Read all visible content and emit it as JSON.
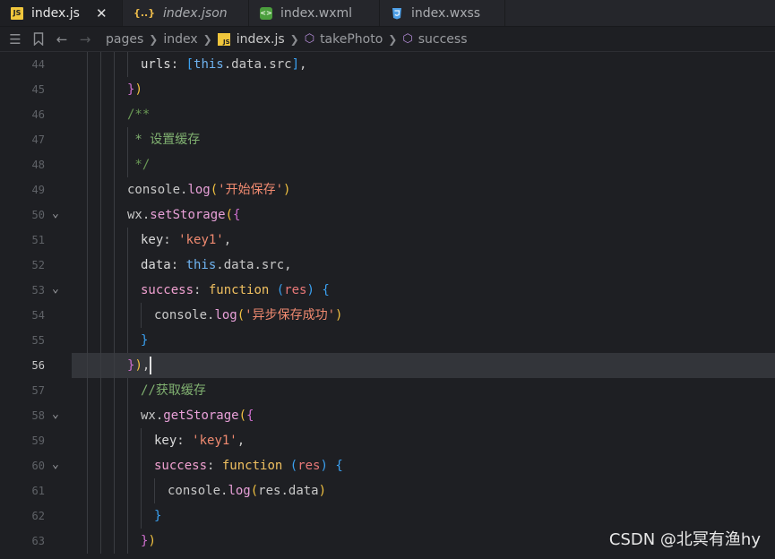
{
  "tabs": [
    {
      "label": "index.js",
      "icon": "js-file-icon",
      "icon_text": "JS",
      "active": true,
      "close": "✕"
    },
    {
      "label": "index.json",
      "icon": "json-file-icon",
      "icon_text": "{..}",
      "italic": true
    },
    {
      "label": "index.wxml",
      "icon": "wxml-file-icon",
      "icon_text": "<>"
    },
    {
      "label": "index.wxss",
      "icon": "css-file-icon",
      "icon_text": "⌘"
    }
  ],
  "breadcrumb": {
    "items": [
      "pages",
      "index",
      "index.js",
      "takePhoto",
      "success"
    ],
    "js_badge": "JS"
  },
  "lines": [
    {
      "num": "44",
      "text": "urls: [this.data.src],"
    },
    {
      "num": "45",
      "text": "})"
    },
    {
      "num": "46",
      "text": "/**"
    },
    {
      "num": "47",
      "text": " * 设置缓存"
    },
    {
      "num": "48",
      "text": " */"
    },
    {
      "num": "49",
      "text": "console.log('开始保存')"
    },
    {
      "num": "50",
      "text": "wx.setStorage({"
    },
    {
      "num": "51",
      "text": "key: 'key1',"
    },
    {
      "num": "52",
      "text": "data: this.data.src,"
    },
    {
      "num": "53",
      "text": "success: function (res) {"
    },
    {
      "num": "54",
      "text": "console.log('异步保存成功')"
    },
    {
      "num": "55",
      "text": "}"
    },
    {
      "num": "56",
      "text": "}),"
    },
    {
      "num": "57",
      "text": "//获取缓存"
    },
    {
      "num": "58",
      "text": "wx.getStorage({"
    },
    {
      "num": "59",
      "text": "key: 'key1',"
    },
    {
      "num": "60",
      "text": "success: function (res) {"
    },
    {
      "num": "61",
      "text": "console.log(res.data)"
    },
    {
      "num": "62",
      "text": "}"
    },
    {
      "num": "63",
      "text": "})"
    }
  ],
  "watermark": "CSDN @北冥有渔hy",
  "colors": {
    "accent": "#f0c63c",
    "background": "#1e1f23"
  }
}
